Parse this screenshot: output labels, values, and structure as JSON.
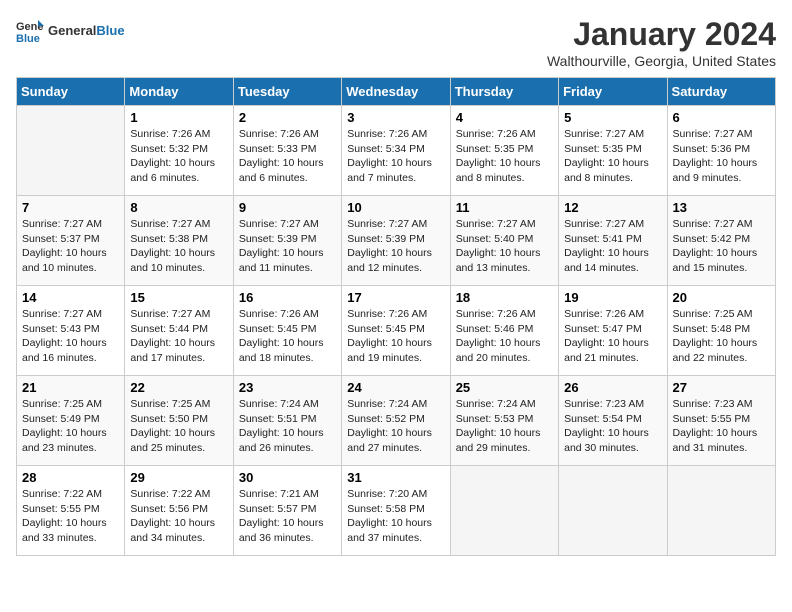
{
  "header": {
    "logo_general": "General",
    "logo_blue": "Blue",
    "title": "January 2024",
    "subtitle": "Walthourville, Georgia, United States"
  },
  "calendar": {
    "days_of_week": [
      "Sunday",
      "Monday",
      "Tuesday",
      "Wednesday",
      "Thursday",
      "Friday",
      "Saturday"
    ],
    "weeks": [
      [
        {
          "day": "",
          "info": ""
        },
        {
          "day": "1",
          "info": "Sunrise: 7:26 AM\nSunset: 5:32 PM\nDaylight: 10 hours\nand 6 minutes."
        },
        {
          "day": "2",
          "info": "Sunrise: 7:26 AM\nSunset: 5:33 PM\nDaylight: 10 hours\nand 6 minutes."
        },
        {
          "day": "3",
          "info": "Sunrise: 7:26 AM\nSunset: 5:34 PM\nDaylight: 10 hours\nand 7 minutes."
        },
        {
          "day": "4",
          "info": "Sunrise: 7:26 AM\nSunset: 5:35 PM\nDaylight: 10 hours\nand 8 minutes."
        },
        {
          "day": "5",
          "info": "Sunrise: 7:27 AM\nSunset: 5:35 PM\nDaylight: 10 hours\nand 8 minutes."
        },
        {
          "day": "6",
          "info": "Sunrise: 7:27 AM\nSunset: 5:36 PM\nDaylight: 10 hours\nand 9 minutes."
        }
      ],
      [
        {
          "day": "7",
          "info": "Sunrise: 7:27 AM\nSunset: 5:37 PM\nDaylight: 10 hours\nand 10 minutes."
        },
        {
          "day": "8",
          "info": "Sunrise: 7:27 AM\nSunset: 5:38 PM\nDaylight: 10 hours\nand 10 minutes."
        },
        {
          "day": "9",
          "info": "Sunrise: 7:27 AM\nSunset: 5:39 PM\nDaylight: 10 hours\nand 11 minutes."
        },
        {
          "day": "10",
          "info": "Sunrise: 7:27 AM\nSunset: 5:39 PM\nDaylight: 10 hours\nand 12 minutes."
        },
        {
          "day": "11",
          "info": "Sunrise: 7:27 AM\nSunset: 5:40 PM\nDaylight: 10 hours\nand 13 minutes."
        },
        {
          "day": "12",
          "info": "Sunrise: 7:27 AM\nSunset: 5:41 PM\nDaylight: 10 hours\nand 14 minutes."
        },
        {
          "day": "13",
          "info": "Sunrise: 7:27 AM\nSunset: 5:42 PM\nDaylight: 10 hours\nand 15 minutes."
        }
      ],
      [
        {
          "day": "14",
          "info": "Sunrise: 7:27 AM\nSunset: 5:43 PM\nDaylight: 10 hours\nand 16 minutes."
        },
        {
          "day": "15",
          "info": "Sunrise: 7:27 AM\nSunset: 5:44 PM\nDaylight: 10 hours\nand 17 minutes."
        },
        {
          "day": "16",
          "info": "Sunrise: 7:26 AM\nSunset: 5:45 PM\nDaylight: 10 hours\nand 18 minutes."
        },
        {
          "day": "17",
          "info": "Sunrise: 7:26 AM\nSunset: 5:45 PM\nDaylight: 10 hours\nand 19 minutes."
        },
        {
          "day": "18",
          "info": "Sunrise: 7:26 AM\nSunset: 5:46 PM\nDaylight: 10 hours\nand 20 minutes."
        },
        {
          "day": "19",
          "info": "Sunrise: 7:26 AM\nSunset: 5:47 PM\nDaylight: 10 hours\nand 21 minutes."
        },
        {
          "day": "20",
          "info": "Sunrise: 7:25 AM\nSunset: 5:48 PM\nDaylight: 10 hours\nand 22 minutes."
        }
      ],
      [
        {
          "day": "21",
          "info": "Sunrise: 7:25 AM\nSunset: 5:49 PM\nDaylight: 10 hours\nand 23 minutes."
        },
        {
          "day": "22",
          "info": "Sunrise: 7:25 AM\nSunset: 5:50 PM\nDaylight: 10 hours\nand 25 minutes."
        },
        {
          "day": "23",
          "info": "Sunrise: 7:24 AM\nSunset: 5:51 PM\nDaylight: 10 hours\nand 26 minutes."
        },
        {
          "day": "24",
          "info": "Sunrise: 7:24 AM\nSunset: 5:52 PM\nDaylight: 10 hours\nand 27 minutes."
        },
        {
          "day": "25",
          "info": "Sunrise: 7:24 AM\nSunset: 5:53 PM\nDaylight: 10 hours\nand 29 minutes."
        },
        {
          "day": "26",
          "info": "Sunrise: 7:23 AM\nSunset: 5:54 PM\nDaylight: 10 hours\nand 30 minutes."
        },
        {
          "day": "27",
          "info": "Sunrise: 7:23 AM\nSunset: 5:55 PM\nDaylight: 10 hours\nand 31 minutes."
        }
      ],
      [
        {
          "day": "28",
          "info": "Sunrise: 7:22 AM\nSunset: 5:55 PM\nDaylight: 10 hours\nand 33 minutes."
        },
        {
          "day": "29",
          "info": "Sunrise: 7:22 AM\nSunset: 5:56 PM\nDaylight: 10 hours\nand 34 minutes."
        },
        {
          "day": "30",
          "info": "Sunrise: 7:21 AM\nSunset: 5:57 PM\nDaylight: 10 hours\nand 36 minutes."
        },
        {
          "day": "31",
          "info": "Sunrise: 7:20 AM\nSunset: 5:58 PM\nDaylight: 10 hours\nand 37 minutes."
        },
        {
          "day": "",
          "info": ""
        },
        {
          "day": "",
          "info": ""
        },
        {
          "day": "",
          "info": ""
        }
      ]
    ]
  }
}
